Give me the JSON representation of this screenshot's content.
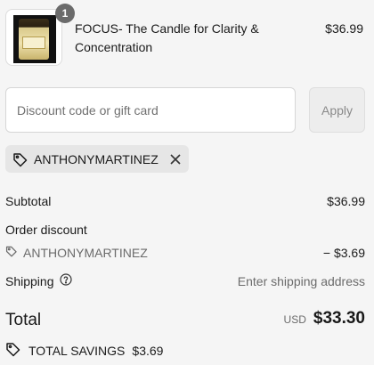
{
  "product": {
    "quantity": "1",
    "title": "FOCUS- The Candle for Clarity & Concentration",
    "price": "$36.99"
  },
  "discount": {
    "placeholder": "Discount code or gift card",
    "apply_label": "Apply",
    "applied_code": "ANTHONYMARTINEZ"
  },
  "summary": {
    "subtotal_label": "Subtotal",
    "subtotal_value": "$36.99",
    "order_discount_label": "Order discount",
    "discount_code": "ANTHONYMARTINEZ",
    "discount_value": "− $3.69",
    "shipping_label": "Shipping",
    "shipping_value": "Enter shipping address",
    "total_label": "Total",
    "currency": "USD",
    "total_value": "$33.30",
    "savings_label": "TOTAL SAVINGS",
    "savings_value": "$3.69"
  },
  "icons": {
    "tag": "tag-icon",
    "close": "close-icon",
    "help": "question-circle-icon",
    "savings": "tags-icon"
  }
}
